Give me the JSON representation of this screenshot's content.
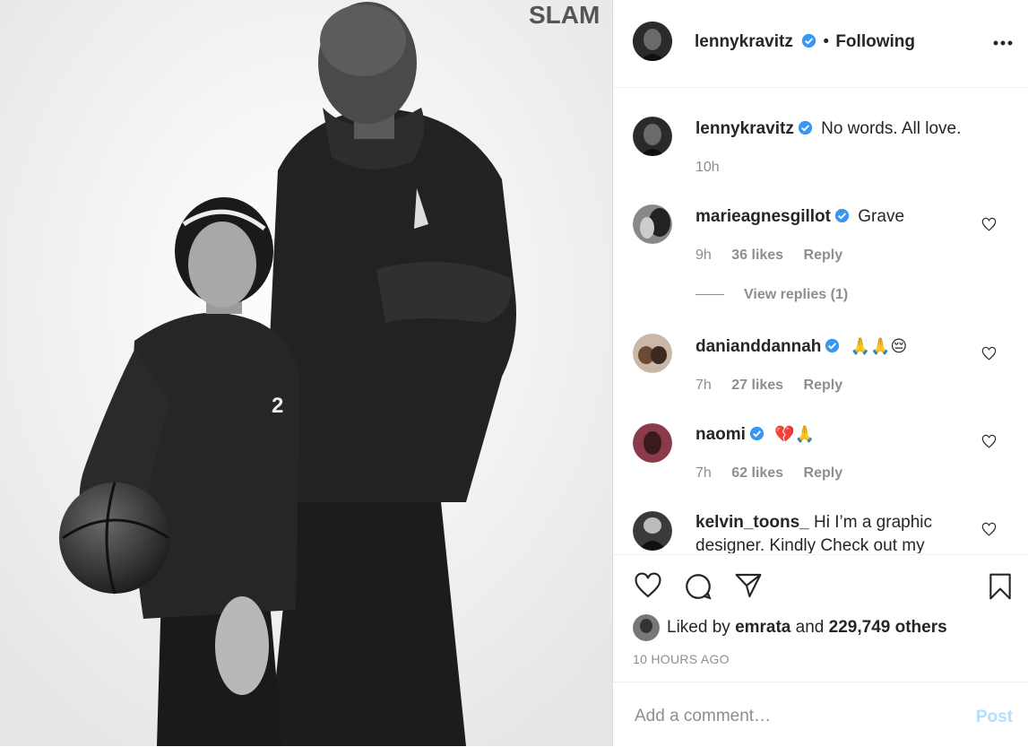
{
  "post": {
    "photo_watermark": "SLAM",
    "jersey_number": "2"
  },
  "header": {
    "username": "lennykravitz",
    "separator": "•",
    "follow_status": "Following",
    "more_icon": "more-options-icon"
  },
  "caption": {
    "username": "lennykravitz",
    "text": "No words. All love.",
    "time": "10h"
  },
  "comments": [
    {
      "username": "marieagnesgillot",
      "verified": true,
      "text": "Grave",
      "time": "9h",
      "likes": "36 likes",
      "reply": "Reply"
    },
    {
      "username": "danianddannah",
      "verified": true,
      "text": "🙏🙏😔",
      "time": "7h",
      "likes": "27 likes",
      "reply": "Reply"
    },
    {
      "username": "naomi",
      "verified": true,
      "text": "💔🙏",
      "time": "7h",
      "likes": "62 likes",
      "reply": "Reply"
    },
    {
      "username": "kelvin_toons_",
      "verified": false,
      "text": "Hi I’m a graphic designer. Kindly Check out my"
    }
  ],
  "view_replies": "View replies (1)",
  "likes": {
    "prefix": "Liked by",
    "user": "emrata",
    "conj": "and",
    "count": "229,749 others"
  },
  "timestamp": "10 HOURS AGO",
  "add_comment": {
    "placeholder": "Add a comment…",
    "post_label": "Post"
  },
  "colors": {
    "verified": "#3897f0",
    "post_disabled": "#b2dffc",
    "muted": "#8e8e8e"
  }
}
